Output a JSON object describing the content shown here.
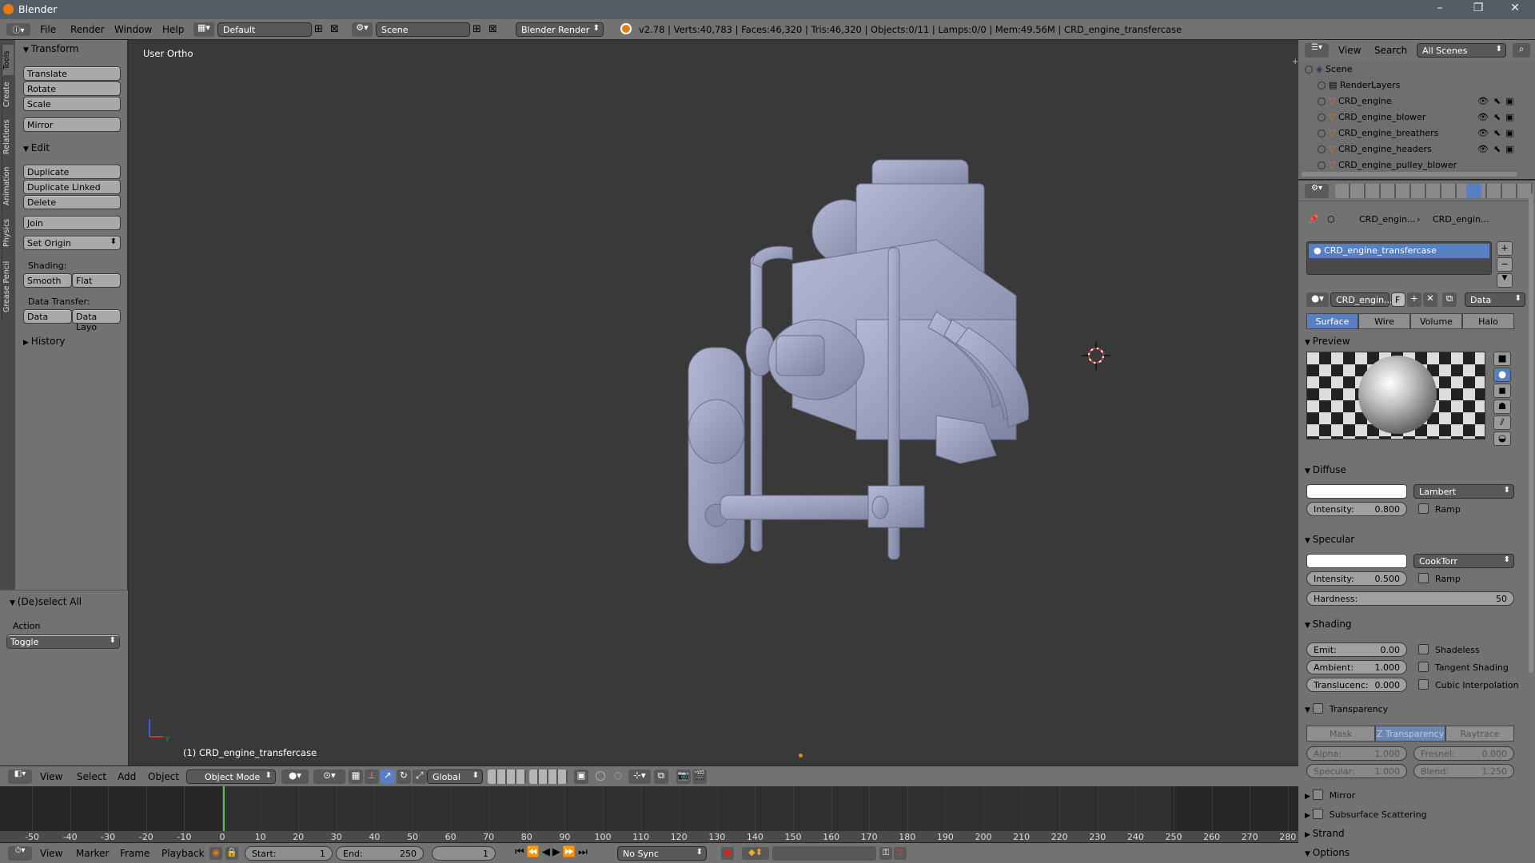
{
  "window": {
    "title": "Blender"
  },
  "menu": {
    "items": [
      "File",
      "Render",
      "Window",
      "Help"
    ],
    "layout": "Default",
    "scene": "Scene",
    "engine": "Blender Render"
  },
  "info": {
    "text": "v2.78 | Verts:40,783 | Faces:46,320 | Tris:46,320 | Objects:0/11 | Lamps:0/0 | Mem:49.56M | CRD_engine_transfercase"
  },
  "tool_tabs": [
    "Tools",
    "Create",
    "Relations",
    "Animation",
    "Physics",
    "Grease Pencil"
  ],
  "tools": {
    "transform_title": "Transform",
    "translate": "Translate",
    "rotate": "Rotate",
    "scale": "Scale",
    "mirror": "Mirror",
    "edit_title": "Edit",
    "duplicate": "Duplicate",
    "duplicate_linked": "Duplicate Linked",
    "delete": "Delete",
    "join": "Join",
    "set_origin": "Set Origin",
    "shading_label": "Shading:",
    "smooth": "Smooth",
    "flat": "Flat",
    "data_transfer_label": "Data Transfer:",
    "data": "Data",
    "data_layo": "Data Layo",
    "history_title": "History",
    "deselect_title": "(De)select All",
    "action_label": "Action",
    "toggle": "Toggle"
  },
  "viewport": {
    "label": "User Ortho",
    "object_label": "(1) CRD_engine_transfercase"
  },
  "viewport_header": {
    "view": "View",
    "select": "Select",
    "add": "Add",
    "object": "Object",
    "mode": "Object Mode",
    "orientation": "Global"
  },
  "timeline": {
    "ticks": [
      "-50",
      "-40",
      "-30",
      "-20",
      "-10",
      "0",
      "10",
      "20",
      "30",
      "40",
      "50",
      "60",
      "70",
      "80",
      "90",
      "100",
      "110",
      "120",
      "130",
      "140",
      "150",
      "160",
      "170",
      "180",
      "190",
      "200",
      "210",
      "220",
      "230",
      "240",
      "250",
      "260",
      "270",
      "280"
    ],
    "current_frame_value": 0
  },
  "timeline_header": {
    "view": "View",
    "marker": "Marker",
    "frame": "Frame",
    "playback": "Playback",
    "start": "Start:",
    "start_val": "1",
    "end": "End:",
    "end_val": "250",
    "current": "1",
    "sync": "No Sync"
  },
  "outliner": {
    "view": "View",
    "search": "Search",
    "filter": "All Scenes",
    "rows": [
      "Scene",
      "RenderLayers",
      "CRD_engine",
      "CRD_engine_blower",
      "CRD_engine_breathers",
      "CRD_engine_headers",
      "CRD_engine_pulley_blower"
    ]
  },
  "properties": {
    "breadcrumb1": "CRD_engin...",
    "breadcrumb2": "CRD_engin...",
    "material_slot": "CRD_engine_transfercase",
    "material_name": "CRD_engin...",
    "f": "F",
    "data": "Data",
    "tabs": [
      "Surface",
      "Wire",
      "Volume",
      "Halo"
    ],
    "preview_title": "Preview",
    "diffuse_title": "Diffuse",
    "diffuse_shader": "Lambert",
    "diffuse_intensity_label": "Intensity:",
    "diffuse_intensity": "0.800",
    "ramp": "Ramp",
    "specular_title": "Specular",
    "specular_shader": "CookTorr",
    "specular_intensity_label": "Intensity:",
    "specular_intensity": "0.500",
    "hardness_label": "Hardness:",
    "hardness": "50",
    "shading_title": "Shading",
    "emit_label": "Emit:",
    "emit": "0.00",
    "shadeless": "Shadeless",
    "ambient_label": "Ambient:",
    "ambient": "1.000",
    "tangent": "Tangent Shading",
    "translucency_label": "Translucenc:",
    "translucency": "0.000",
    "cubic": "Cubic Interpolation",
    "transparency_title": "Transparency",
    "trans_tabs": [
      "Mask",
      "Z Transparency",
      "Raytrace"
    ],
    "alpha_label": "Alpha:",
    "alpha": "1.000",
    "fresnel_label": "Fresnel:",
    "fresnel": "0.000",
    "specular2_label": "Specular:",
    "specular2": "1.000",
    "blend_label": "Blend:",
    "blend": "1.250",
    "mirror_title": "Mirror",
    "sss_title": "Subsurface Scattering",
    "strand_title": "Strand",
    "options_title": "Options"
  },
  "colors": {
    "accent": "#5680c2",
    "header": "#727272",
    "viewport": "#393939",
    "model": "#9a9fbe"
  }
}
